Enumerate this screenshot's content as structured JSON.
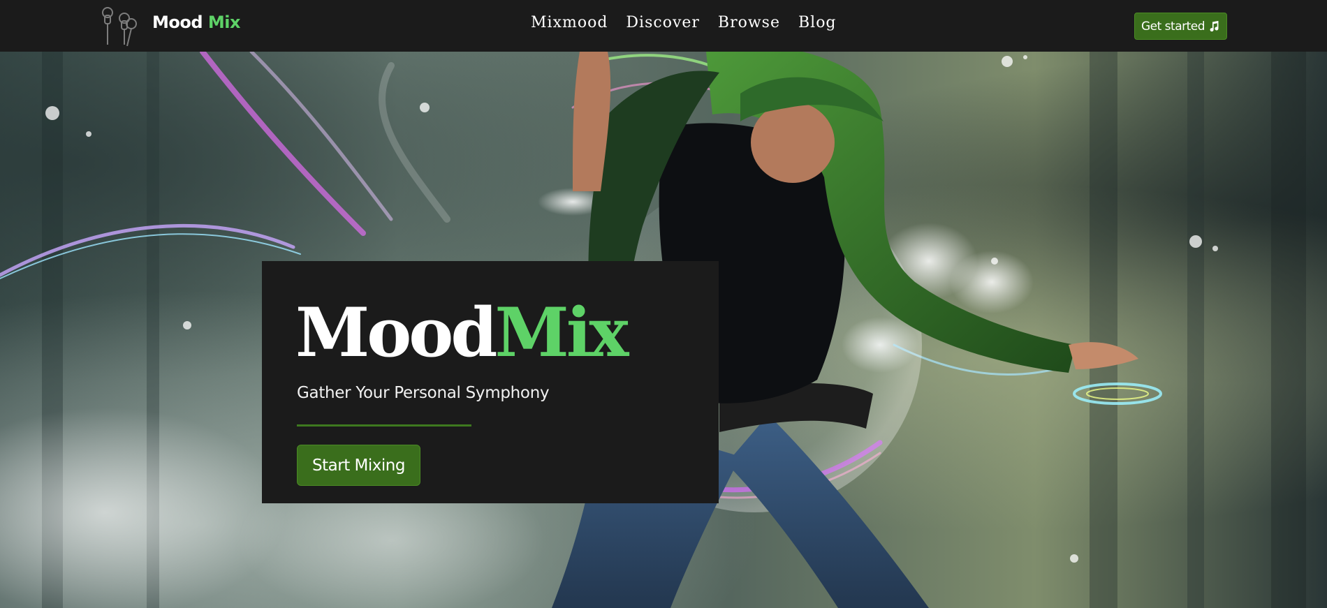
{
  "brand": {
    "name_part1": "Mood",
    "name_part2": "Mix",
    "logo_icon": "earbuds-icon"
  },
  "nav": {
    "links": [
      {
        "label": "Mixmood"
      },
      {
        "label": "Discover"
      },
      {
        "label": "Browse"
      },
      {
        "label": "Blog"
      }
    ],
    "cta_label": "Get started",
    "cta_icon": "music-note-icon"
  },
  "hero": {
    "title_part1": "Mood",
    "title_part2": "Mix",
    "subtitle": "Gather Your Personal Symphony",
    "button_label": "Start Mixing",
    "background": "dancer-photo"
  },
  "colors": {
    "accent_green": "#5ed267",
    "button_green": "#3a6e1c",
    "dark_bg": "#1b1b1b",
    "text_white": "#ffffff"
  }
}
